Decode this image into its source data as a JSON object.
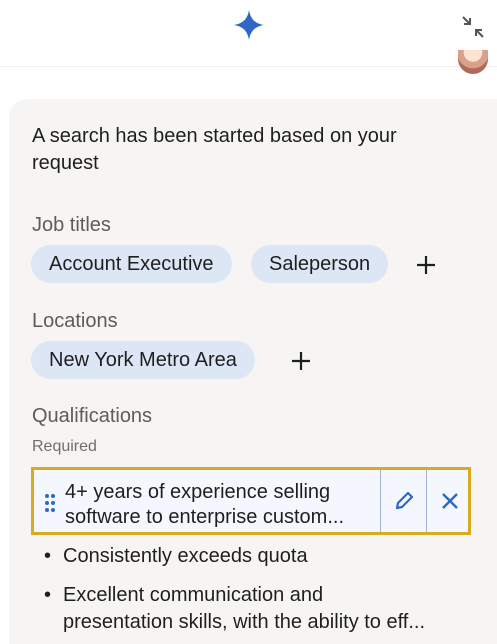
{
  "header": {
    "logo_icon": "sparkle-icon",
    "collapse_icon": "collapse-arrows-icon",
    "accent_color": "#2e67c7"
  },
  "message": {
    "line1": "A search has been started based on your",
    "line2": "request"
  },
  "job_titles": {
    "label": "Job titles",
    "chips": [
      "Account Executive",
      "Saleperson"
    ]
  },
  "locations": {
    "label": "Locations",
    "chips": [
      "New York Metro Area"
    ]
  },
  "qualifications": {
    "label": "Qualifications",
    "sublabel": "Required",
    "selected": {
      "line1": "4+ years of experience selling",
      "line2": "software to enterprise custom..."
    },
    "items": [
      {
        "line1": "Consistently exceeds quota"
      },
      {
        "line1": "Excellent communication and",
        "line2": "presentation skills, with the ability to eff..."
      }
    ]
  },
  "bullet_char": "•"
}
